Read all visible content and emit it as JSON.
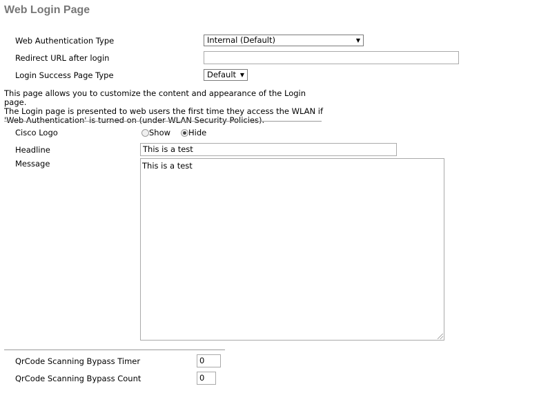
{
  "page": {
    "title": "Web Login Page"
  },
  "form": {
    "auth_type_label": "Web Authentication Type",
    "auth_type_value": "Internal (Default)",
    "redirect_label": "Redirect URL after login",
    "redirect_value": "",
    "success_type_label": "Login Success Page Type",
    "success_type_value": "Default"
  },
  "description": {
    "line1": "This page allows you to customize the content and appearance of the Login page.",
    "line2": "The Login page is presented to web users the first time they access the WLAN if",
    "line3": "'Web Authentication' is turned on (under WLAN Security Policies)."
  },
  "customize": {
    "logo_label": "Cisco Logo",
    "logo_show": "Show",
    "logo_hide": "Hide",
    "logo_selected": "Hide",
    "headline_label": "Headline",
    "headline_value": "This is a test",
    "message_label": "Message",
    "message_value": "This is a test"
  },
  "qrcode": {
    "timer_label": "QrCode Scanning Bypass Timer",
    "timer_value": "0",
    "count_label": "QrCode Scanning Bypass Count",
    "count_value": "0"
  },
  "icons": {
    "dropdown": "chevron-down-icon",
    "resize": "resize-grip-icon"
  }
}
